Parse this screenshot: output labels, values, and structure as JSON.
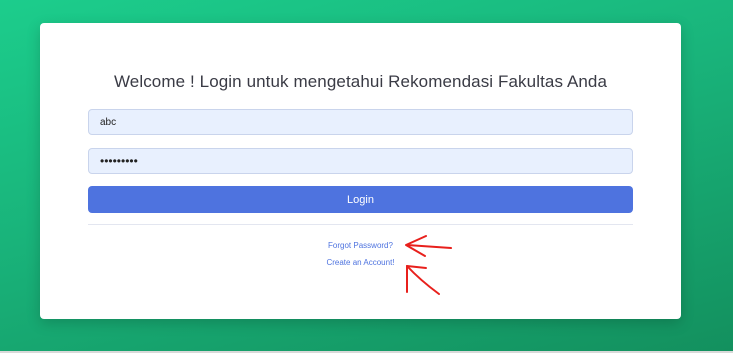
{
  "login": {
    "title": "Welcome ! Login untuk mengetahui Rekomendasi Fakultas Anda",
    "username_value": "abc",
    "password_value": "abcdefghi",
    "login_label": "Login",
    "forgot_label": "Forgot Password?",
    "create_label": "Create an Account!"
  },
  "colors": {
    "background": "#1ccd8c",
    "primary": "#4e73df",
    "input_fill": "#e8f0fe",
    "annotation": "#e8201c"
  },
  "annotations": {
    "arrow_1": "red-arrow-icon",
    "arrow_2": "red-arrow-icon"
  }
}
